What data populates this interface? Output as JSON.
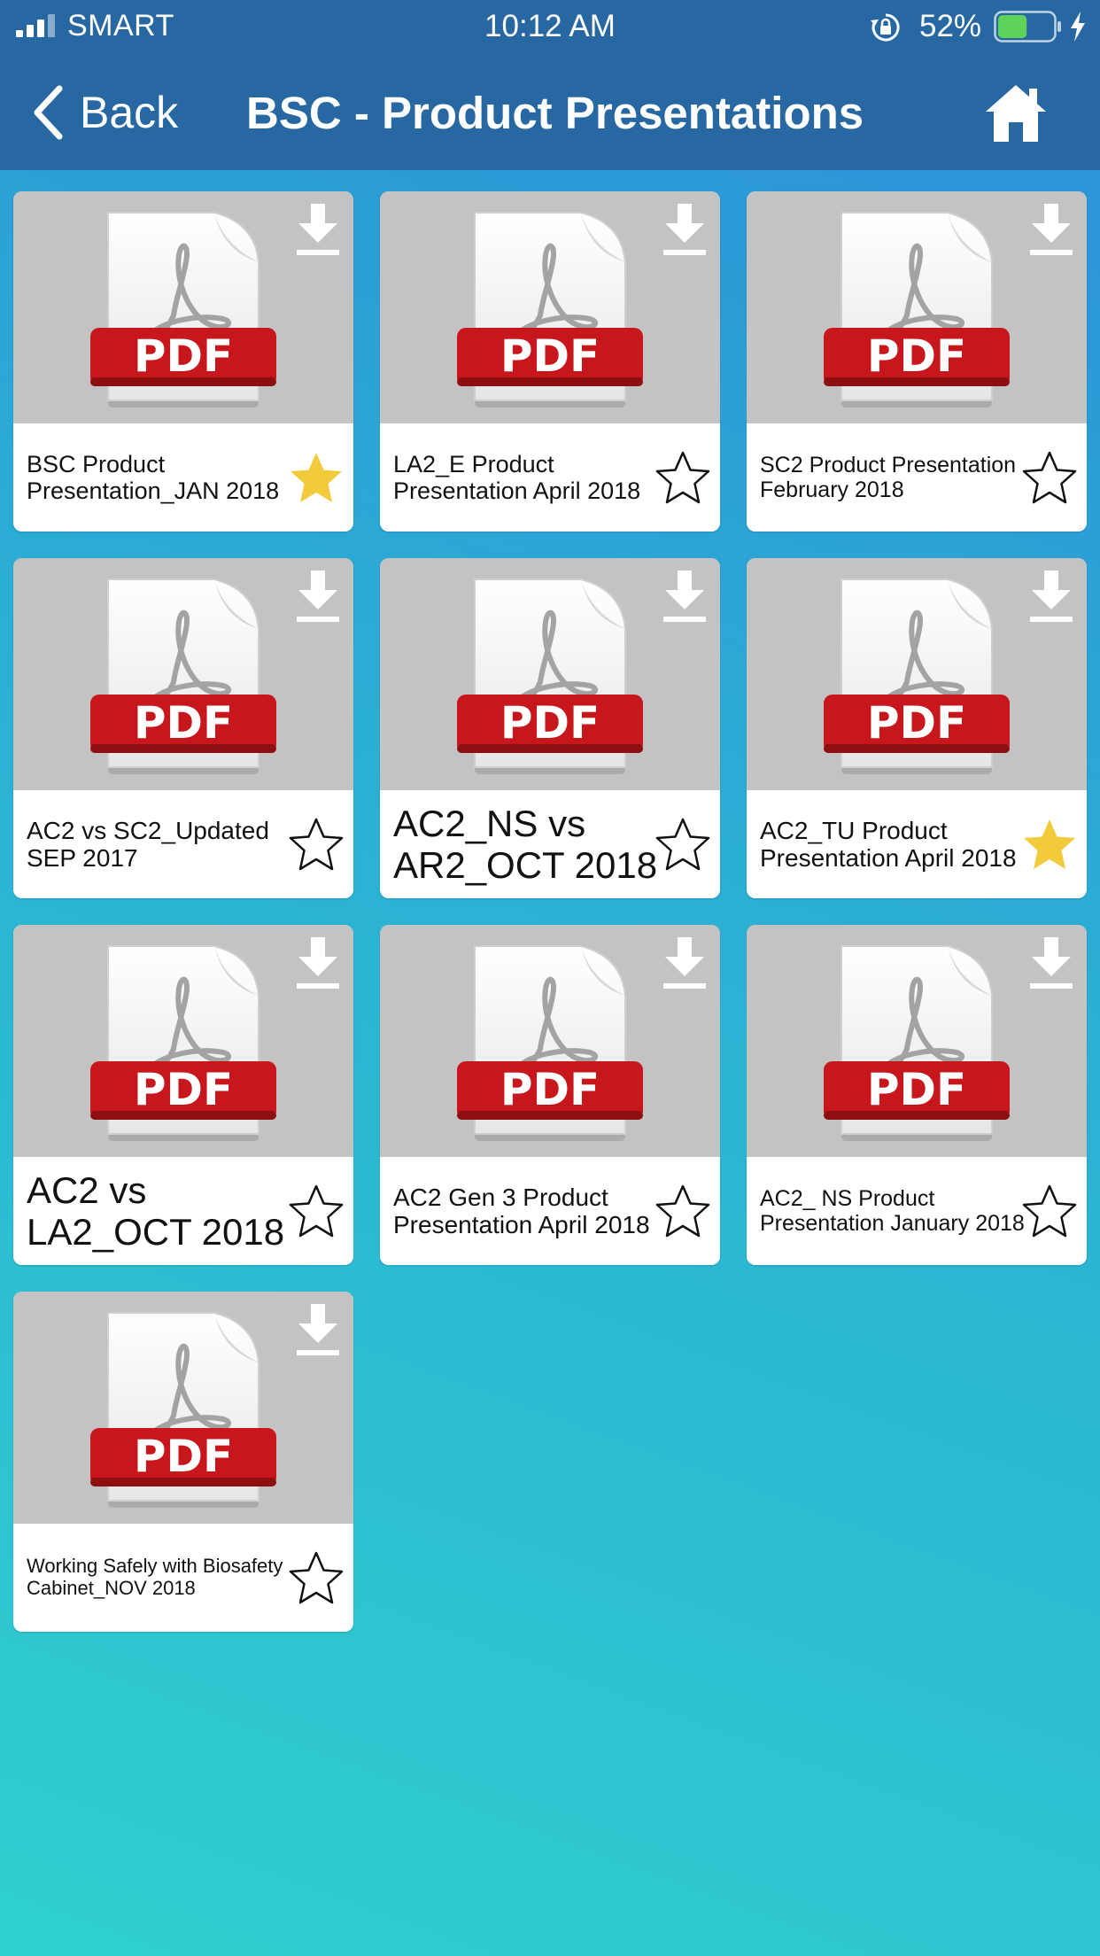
{
  "status_bar": {
    "carrier": "SMART",
    "time": "10:12 AM",
    "battery_percent": "52%",
    "battery_level": 0.52,
    "icons": [
      "signal-icon",
      "rotation-lock-icon",
      "battery-icon",
      "charging-bolt-icon"
    ]
  },
  "nav": {
    "back_label": "Back",
    "title": "BSC - Product Presentations",
    "home_icon": "home-icon"
  },
  "colors": {
    "header": "#2768a2",
    "background_top": "#2d8fd9",
    "background_bottom": "#2fcfcf",
    "thumb_bg": "#c3c3c3",
    "pdf_red": "#c8171c",
    "star_gold": "#f2cb3c",
    "battery_green": "#5ed35a"
  },
  "documents": [
    {
      "title": "BSC Product Presentation_JAN 2018",
      "favorite": true,
      "badge": "PDF"
    },
    {
      "title": "LA2_E Product Presentation April 2018",
      "favorite": false,
      "badge": "PDF"
    },
    {
      "title": "SC2 Product Presentation February 2018",
      "favorite": false,
      "badge": "PDF"
    },
    {
      "title": "AC2 vs SC2_Updated SEP 2017",
      "favorite": false,
      "badge": "PDF"
    },
    {
      "title": "AC2_NS vs AR2_OCT 2018",
      "favorite": false,
      "badge": "PDF"
    },
    {
      "title": "AC2_TU Product Presentation April 2018",
      "favorite": true,
      "badge": "PDF"
    },
    {
      "title": "AC2 vs LA2_OCT 2018",
      "favorite": false,
      "badge": "PDF"
    },
    {
      "title": "AC2 Gen 3 Product Presentation April 2018",
      "favorite": false,
      "badge": "PDF"
    },
    {
      "title": "AC2_ NS Product Presentation January 2018",
      "favorite": false,
      "badge": "PDF"
    },
    {
      "title": "Working Safely with Biosafety Cabinet_NOV 2018",
      "favorite": false,
      "badge": "PDF"
    }
  ]
}
